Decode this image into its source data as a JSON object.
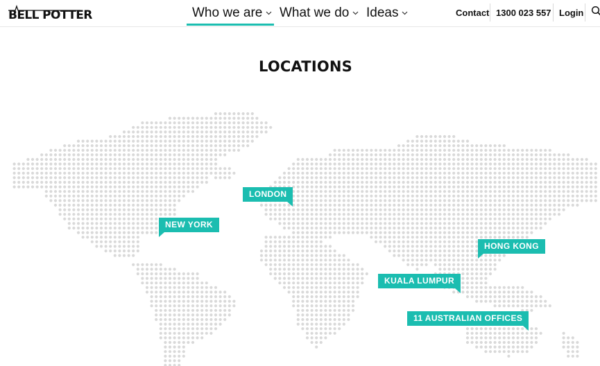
{
  "brand": {
    "logo_text": "BELL POTTER"
  },
  "nav": {
    "items": [
      {
        "label": "Who we are",
        "active": true
      },
      {
        "label": "What we do",
        "active": false
      },
      {
        "label": "Ideas",
        "active": false
      }
    ]
  },
  "utility": {
    "contact": "Contact",
    "phone": "1300 023 557",
    "login": "Login"
  },
  "page": {
    "title": "LOCATIONS"
  },
  "locations": [
    {
      "name": "NEW YORK"
    },
    {
      "name": "LONDON"
    },
    {
      "name": "HONG KONG"
    },
    {
      "name": "KUALA LUMPUR"
    },
    {
      "name": "11 AUSTRALIAN OFFICES"
    }
  ],
  "colors": {
    "accent": "#1bbdb0",
    "map_dot": "#d9d9d9",
    "text": "#111111"
  },
  "icons": {
    "nav_dropdown": "chevron-down-icon",
    "search": "search-icon"
  }
}
